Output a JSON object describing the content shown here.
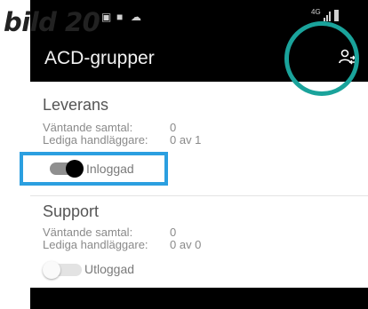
{
  "annotation": {
    "label": "bild 20"
  },
  "status_bar": {
    "network": "4G",
    "icons": [
      "image-icon",
      "bag-icon",
      "cloud-icon",
      "signal-icon",
      "battery-icon"
    ]
  },
  "app_bar": {
    "title": "ACD-grupper",
    "action_icon": "agent-switch-icon"
  },
  "groups": [
    {
      "name": "Leverans",
      "waiting_label": "Väntande samtal:",
      "waiting_value": "0",
      "agents_label": "Lediga handläggare:",
      "agents_value": "0 av 1",
      "toggle_state": true,
      "toggle_label": "Inloggad"
    },
    {
      "name": "Support",
      "waiting_label": "Väntande samtal:",
      "waiting_value": "0",
      "agents_label": "Lediga handläggare:",
      "agents_value": "0 av 0",
      "toggle_state": false,
      "toggle_label": "Utloggad"
    }
  ],
  "colors": {
    "highlight_ring": "#1aa39b",
    "highlight_box": "#2b9fe0",
    "bar": "#000000"
  }
}
